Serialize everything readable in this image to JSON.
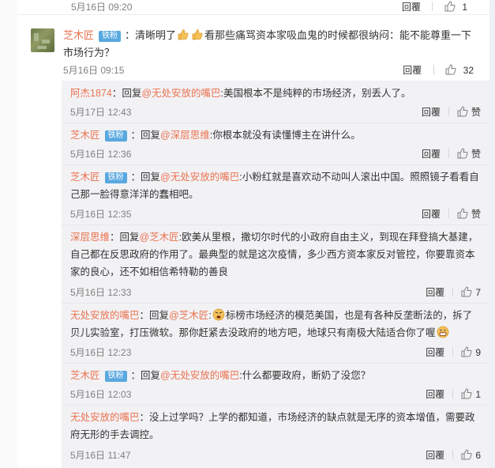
{
  "top": {
    "time": "5月16日 09:20",
    "reply_label": "回覆",
    "likes": "1"
  },
  "main": {
    "user": "芝木匠",
    "badge": "铁粉",
    "text_before": "：清晰明了",
    "text_after": "看那些痛骂资本家吸血鬼的时候都很纳闷：能不能尊重一下市场行为？",
    "time": "5月16日 09:15",
    "reply_label": "回覆",
    "likes": "32"
  },
  "replies": [
    {
      "user": "阿杰1874",
      "badge": "",
      "prefix": "：回复",
      "at": "@无处安放的嘴巴",
      "text": ":美国根本不是纯粹的市场经济，别丢人了。",
      "time": "5月17日 12:43",
      "reply_label": "回覆",
      "likes": "赞"
    },
    {
      "user": "芝木匠",
      "badge": "铁粉",
      "prefix": "：回复",
      "at": "@深层思维",
      "text": ":你根本就没有读懂博主在讲什么。",
      "time": "5月16日 12:36",
      "reply_label": "回覆",
      "likes": "赞"
    },
    {
      "user": "芝木匠",
      "badge": "铁粉",
      "prefix": "：回复",
      "at": "@无处安放的嘴巴",
      "text": ":小粉红就是喜欢动不动叫人滚出中国。照照镜子看看自己那一脸得意洋洋的蠢相吧。",
      "time": "5月16日 12:35",
      "reply_label": "回覆",
      "likes": "赞"
    },
    {
      "user": "深层思维",
      "badge": "",
      "prefix": "：回复",
      "at": "@芝木匠",
      "text": ":欧美从里根，撒切尔时代的小政府自由主义，到现在拜登搞大基建，自己都在反思政府的作用了。最典型的就是这次疫情，多少西方资本家反对管控，你要靠资本家的良心，还不如相信希特勒的善良",
      "time": "5月16日 12:33",
      "reply_label": "回覆",
      "likes": "7"
    },
    {
      "user": "无处安放的嘴巴",
      "badge": "",
      "prefix": "：回复",
      "at": "@芝木匠",
      "text_a": ":",
      "text": "标榜市场经济的模范美国，也是有各种反垄断法的，拆了贝儿实验室，打压微软。那你赶紧去没政府的地方吧，地球只有南极大陆适合你了喔",
      "time": "5月16日 12:23",
      "reply_label": "回覆",
      "likes": "9"
    },
    {
      "user": "芝木匠",
      "badge": "铁粉",
      "prefix": "：回复",
      "at": "@无处安放的嘴巴",
      "text": ":什么都要政府，断奶了没您？",
      "time": "5月16日 12:03",
      "reply_label": "回覆",
      "likes": "1"
    },
    {
      "user": "无处安放的嘴巴",
      "badge": "",
      "prefix": "",
      "at": "",
      "text": "：没上过学吗？上学的都知道，市场经济的缺点就是无序的资本增值，需要政府无形的手去调控。",
      "time": "5月16日 11:47",
      "reply_label": "回覆",
      "likes": "6"
    }
  ],
  "icons": {
    "like": "thumbs-up-icon",
    "emoji_thumbs": "thumbs-up-emoji",
    "emoji_angry": "angry-face-emoji",
    "emoji_grin": "grin-face-emoji"
  },
  "colors": {
    "username": "#eb7350",
    "badge": "#59a8e0",
    "reply_bg": "#f2f2f5"
  }
}
